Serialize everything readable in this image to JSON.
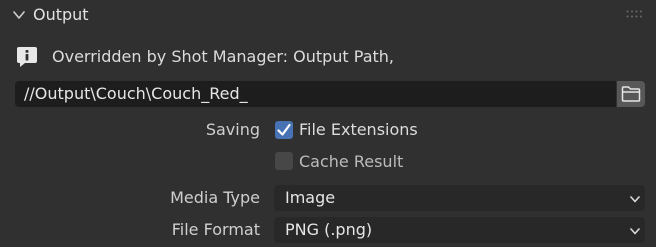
{
  "header": {
    "title": "Output"
  },
  "info": {
    "message": "Overridden by Shot Manager: Output Path,"
  },
  "output_path": {
    "value": "//Output\\Couch\\Couch_Red_"
  },
  "saving": {
    "label": "Saving",
    "file_extensions": {
      "label": "File Extensions",
      "checked": true
    },
    "cache_result": {
      "label": "Cache Result",
      "checked": false
    }
  },
  "media_type": {
    "label": "Media Type",
    "value": "Image"
  },
  "file_format": {
    "label": "File Format",
    "value": "PNG (.png)"
  },
  "colors": {
    "panel_bg": "#303030",
    "field_bg": "#1d1d1d",
    "checkbox_on": "#4772b3",
    "checkbox_off": "#474747",
    "button_bg": "#585858"
  },
  "icons": {
    "header_toggle": "chevron-down-icon",
    "drag_handle": "grip-icon",
    "info": "info-icon",
    "browse": "folder-icon",
    "check": "checkmark-icon",
    "dropdown": "chevron-down-icon"
  }
}
